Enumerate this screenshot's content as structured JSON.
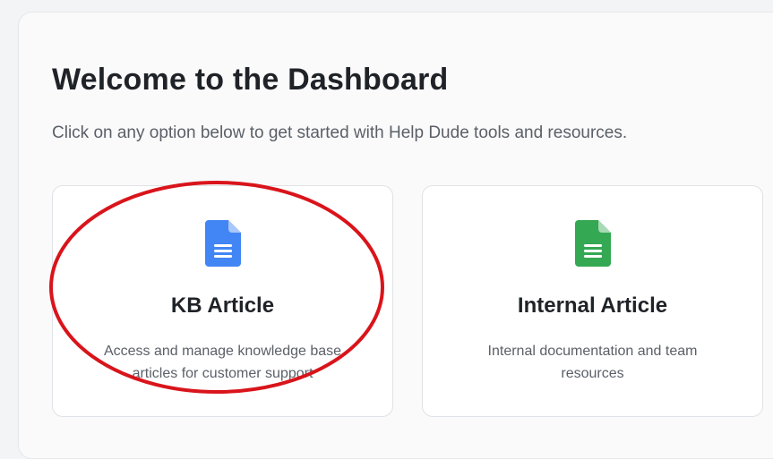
{
  "header": {
    "title": "Welcome to the Dashboard",
    "subtitle": "Click on any option below to get started with Help Dude tools and resources."
  },
  "cards": [
    {
      "title": "KB Article",
      "description": "Access and manage knowledge base articles for customer support",
      "icon": "document-icon",
      "icon_color": "#4285f4"
    },
    {
      "title": "Internal Article",
      "description": "Internal documentation and team resources",
      "icon": "document-icon",
      "icon_color": "#34a853"
    }
  ],
  "annotation": {
    "shape": "ellipse",
    "color": "#d9141b",
    "target": "KB Article"
  }
}
